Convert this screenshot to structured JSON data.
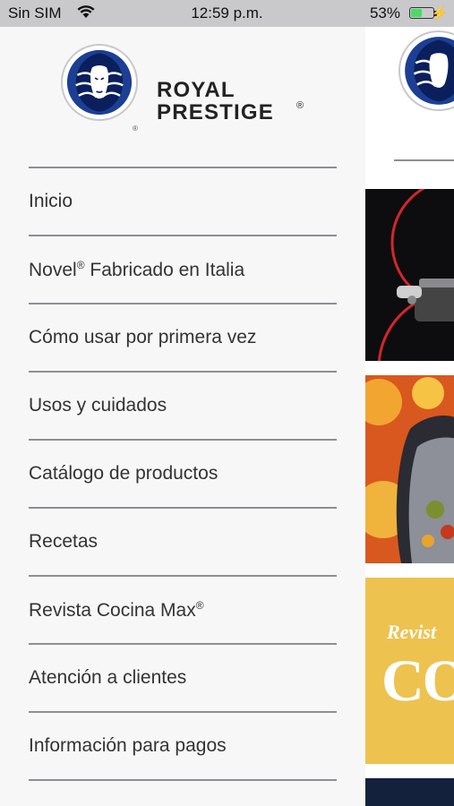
{
  "status_bar": {
    "carrier": "Sin SIM",
    "time": "12:59 p.m.",
    "battery_percent": "53%",
    "battery_level": 0.53,
    "colors": {
      "battery_fill": "#4cd964"
    }
  },
  "brand": {
    "line1": "ROYAL",
    "line2": "PRESTIGE",
    "registered": "®",
    "registered_small": "®",
    "colors": {
      "emblem_blue": "#1c3f94",
      "emblem_dark": "#0a1f5c"
    }
  },
  "menu": {
    "items": [
      {
        "label": "Inicio"
      },
      {
        "label": "Novel",
        "reg": "®",
        "rest": " Fabricado en Italia"
      },
      {
        "label": "Cómo usar por primera vez"
      },
      {
        "label": "Usos y cuidados"
      },
      {
        "label": "Catálogo de productos"
      },
      {
        "label": "Recetas"
      },
      {
        "label": "Revista Cocina Max",
        "reg": "®"
      },
      {
        "label": "Atención a clientes"
      },
      {
        "label": "Información para pagos"
      }
    ]
  },
  "peek": {
    "revista_text": "Revist",
    "co_text": "CO"
  }
}
